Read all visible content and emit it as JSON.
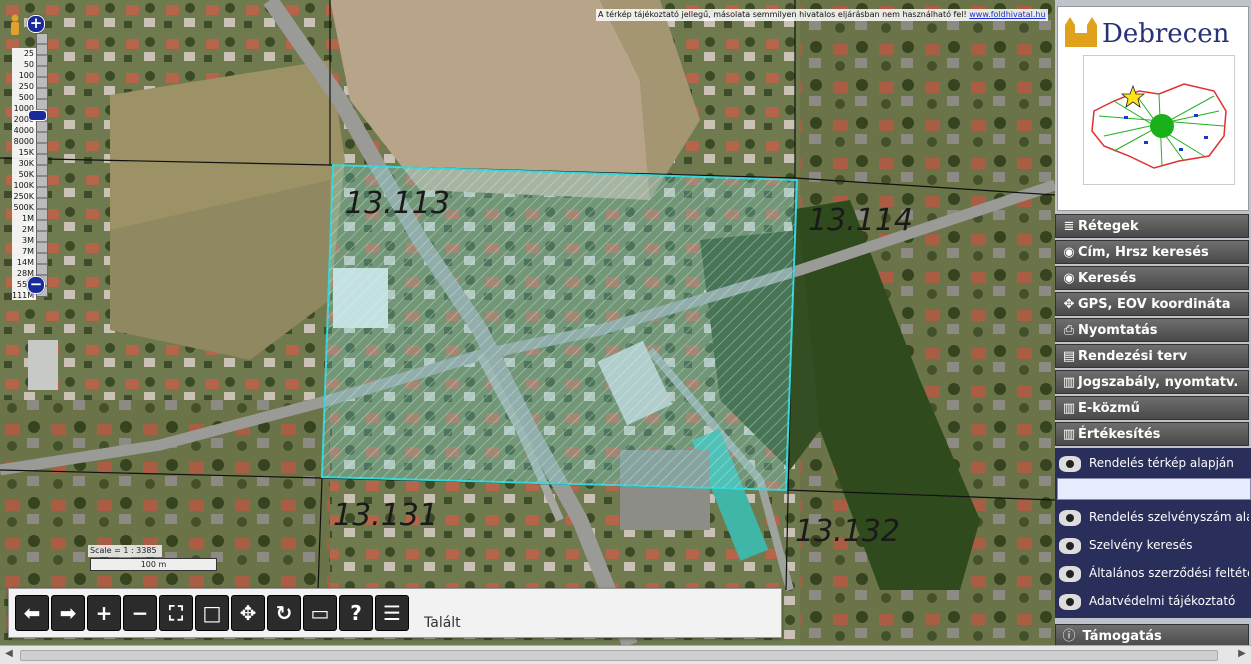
{
  "disclaimer": {
    "text": "A térkép tájékoztató jellegű, másolata semmilyen hivatalos eljárásban nem használható fel!",
    "link": "www.foldhivatal.hu"
  },
  "zoom": {
    "plus": "+",
    "minus": "−",
    "levels": [
      "25",
      "50",
      "100",
      "250",
      "500",
      "1000",
      "2000",
      "4000",
      "8000",
      "15K",
      "30K",
      "50K",
      "100K",
      "250K",
      "500K",
      "1M",
      "2M",
      "3M",
      "7M",
      "14M",
      "28M",
      "55M",
      "111M"
    ]
  },
  "parcels": [
    {
      "label": "13.113"
    },
    {
      "label": "13.114"
    },
    {
      "label": "13.131"
    },
    {
      "label": "13.132"
    }
  ],
  "scale": {
    "ratio": "Scale = 1 : 3385",
    "bar": "100 m"
  },
  "logo": {
    "city": "Debrecen"
  },
  "menu": [
    {
      "icon": "layers-icon",
      "glyph": "≣",
      "label": "Rétegek"
    },
    {
      "icon": "eye-icon",
      "glyph": "◉",
      "label": "Cím, Hrsz keresés"
    },
    {
      "icon": "eye-icon",
      "glyph": "◉",
      "label": "Keresés"
    },
    {
      "icon": "crosshair-icon",
      "glyph": "✥",
      "label": "GPS, EOV koordináta"
    },
    {
      "icon": "printer-icon",
      "glyph": "⎙",
      "label": "Nyomtatás"
    },
    {
      "icon": "plan-icon",
      "glyph": "▤",
      "label": "Rendezési terv"
    },
    {
      "icon": "book-icon",
      "glyph": "▥",
      "label": "Jogszabály, nyomtatv."
    },
    {
      "icon": "book-icon",
      "glyph": "▥",
      "label": "E-közmű"
    },
    {
      "icon": "book-icon",
      "glyph": "▥",
      "label": "Értékesítés"
    }
  ],
  "submenu": [
    {
      "label": "Rendelés térkép alapján"
    },
    {
      "label": "Rendelés szelvényszám alapján"
    },
    {
      "label": "Szelvény keresés"
    },
    {
      "label": "Általános szerződési feltételek"
    },
    {
      "label": "Adatvédelmi tájékoztató"
    }
  ],
  "support": {
    "glyph": "ⓘ",
    "label": "Támogatás"
  },
  "toolbar": {
    "buttons": [
      {
        "name": "back-arrow-button",
        "glyph": "⬅"
      },
      {
        "name": "forward-arrow-button",
        "glyph": "➡"
      },
      {
        "name": "zoom-in-button",
        "glyph": "+"
      },
      {
        "name": "zoom-out-button",
        "glyph": "−"
      },
      {
        "name": "zoom-box-button",
        "glyph": "⛶"
      },
      {
        "name": "full-extent-button",
        "glyph": "□"
      },
      {
        "name": "pan-button",
        "glyph": "✥"
      },
      {
        "name": "refresh-button",
        "glyph": "↻"
      },
      {
        "name": "measure-button",
        "glyph": "▭"
      },
      {
        "name": "help-button",
        "glyph": "?"
      },
      {
        "name": "document-button",
        "glyph": "☰"
      }
    ],
    "status": "Talált"
  },
  "colors": {
    "selection": "#37d6d6",
    "menu_bg": "#555555",
    "submenu_bg": "#2a2e5a",
    "zoom_btn": "#1b2a9a"
  }
}
